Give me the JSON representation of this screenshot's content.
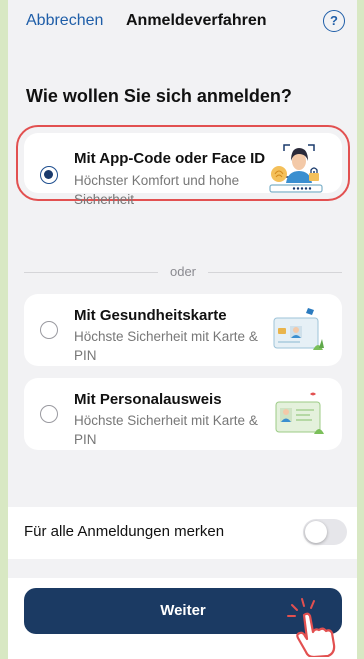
{
  "nav": {
    "cancel_label": "Abbrechen",
    "title": "Anmeldeverfahren",
    "help_glyph": "?"
  },
  "heading": "Wie wollen Sie sich anmelden?",
  "options": [
    {
      "title": "Mit App-Code oder Face ID",
      "desc": "Höchster Komfort und hohe Sicherheit",
      "selected": true,
      "icon": "face-id-illustration"
    },
    {
      "title": "Mit Gesundheitskarte",
      "desc": "Höchste Sicherheit mit Karte & PIN",
      "selected": false,
      "icon": "health-card-illustration"
    },
    {
      "title": "Mit Personalausweis",
      "desc": "Höchste Sicherheit mit Karte & PIN",
      "selected": false,
      "icon": "id-card-illustration"
    }
  ],
  "divider_label": "oder",
  "remember": {
    "label": "Für alle Anmeldungen merken",
    "enabled": false
  },
  "continue_label": "Weiter",
  "colors": {
    "accent": "#1b3a63",
    "link": "#1f5ea8",
    "highlight": "#e25050"
  }
}
